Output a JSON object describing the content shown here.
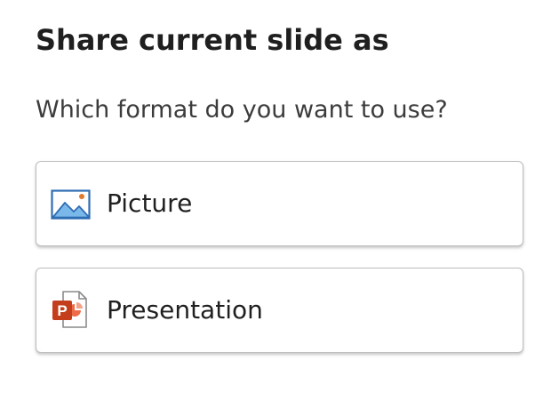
{
  "dialog": {
    "title": "Share current slide as",
    "subtitle": "Which format do you want to use?"
  },
  "options": [
    {
      "label": "Picture",
      "icon": "picture-icon"
    },
    {
      "label": "Presentation",
      "icon": "powerpoint-icon"
    }
  ],
  "colors": {
    "picture_blue": "#5fa7e6",
    "picture_blue_dark": "#2f6db3",
    "picture_accent": "#e07a2f",
    "powerpoint_red": "#c43e1c",
    "powerpoint_orange": "#ed6c47"
  }
}
